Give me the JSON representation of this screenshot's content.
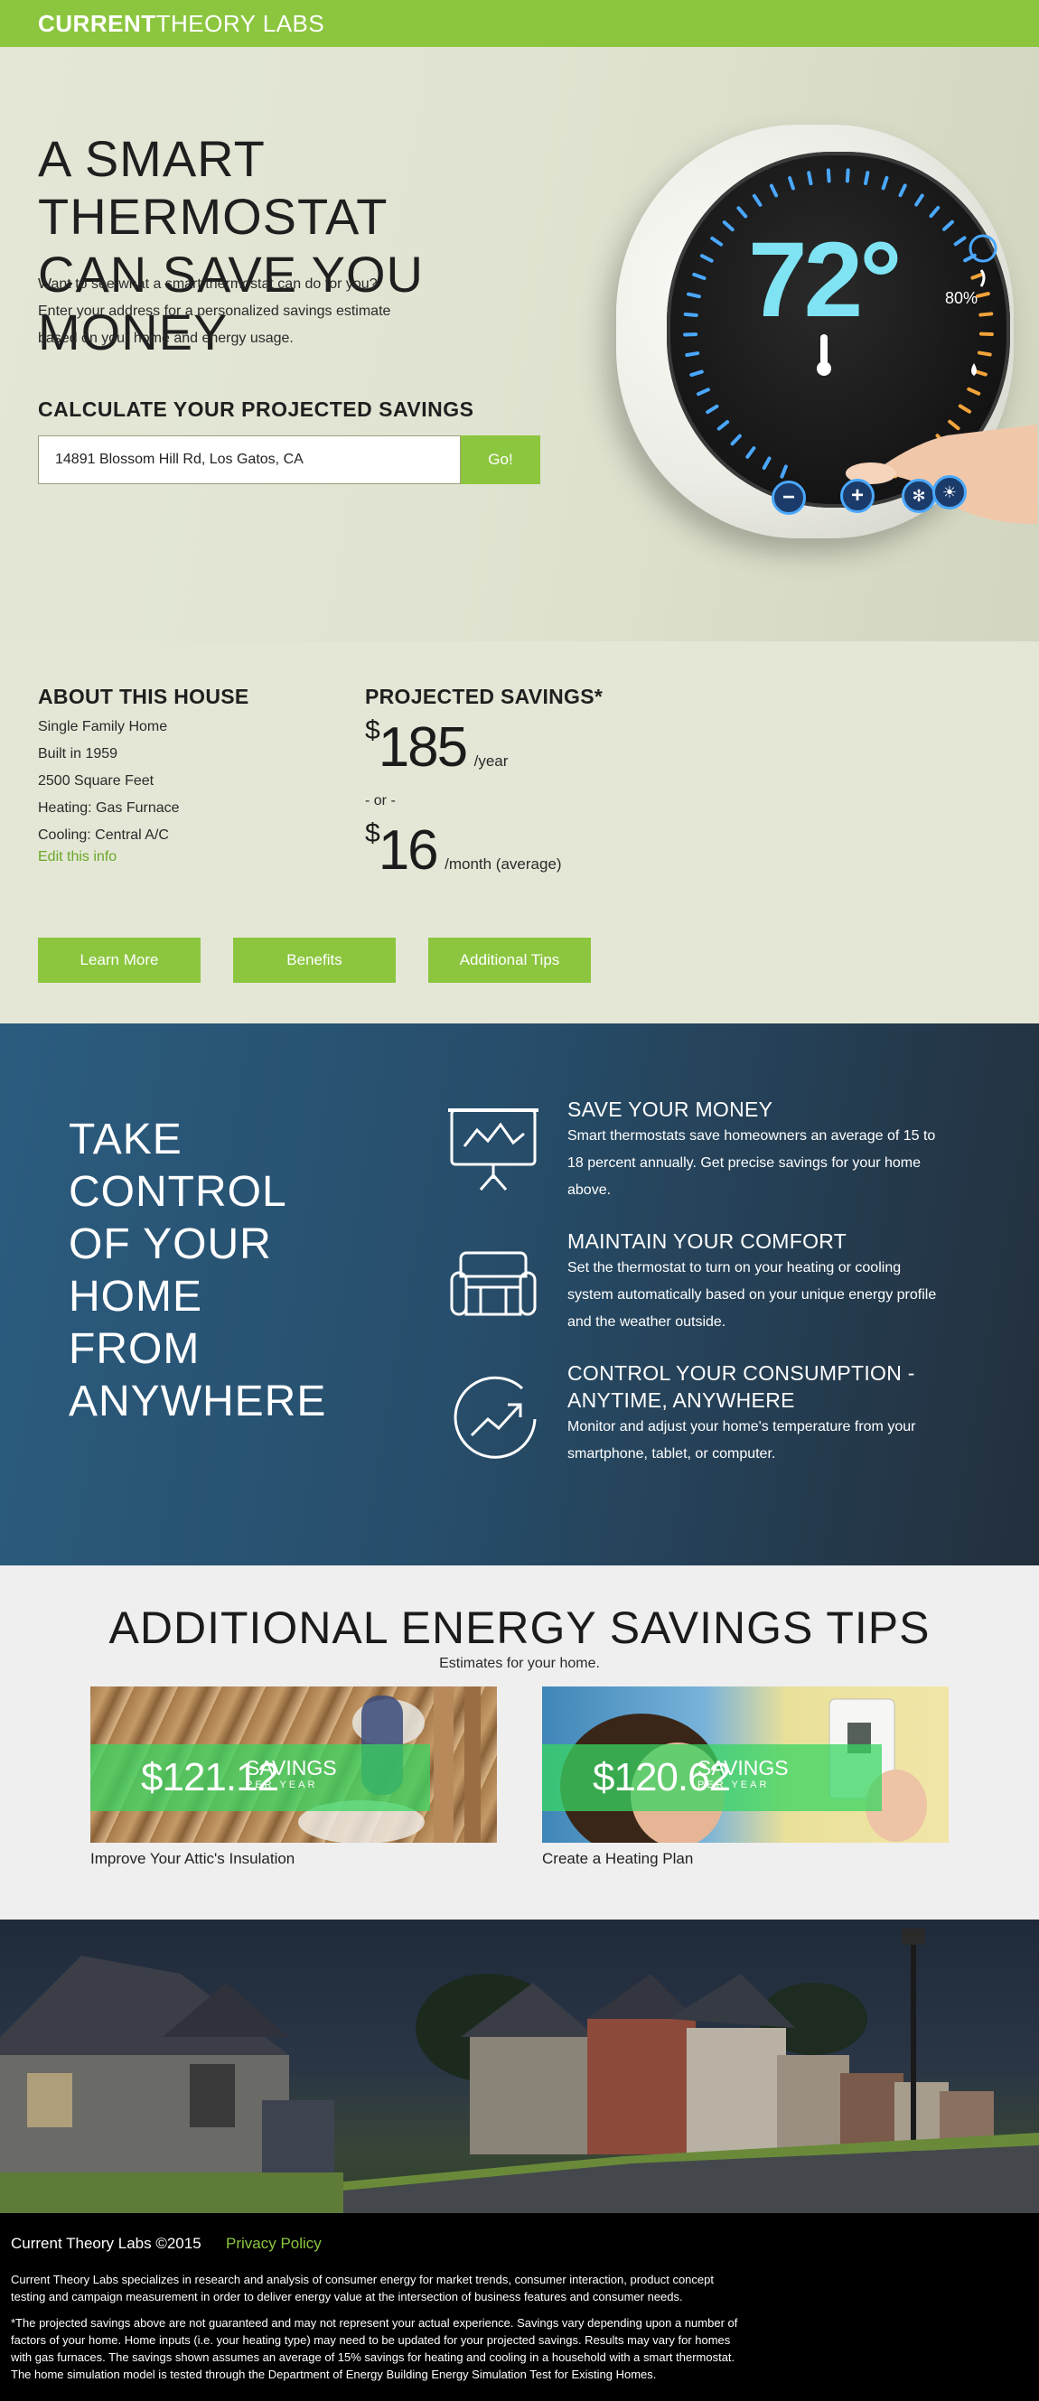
{
  "brand": {
    "bold": "CURRENT",
    "light": "THEORY LABS"
  },
  "hero": {
    "title_line1": "A SMART THERMOSTAT",
    "title_line2": "CAN SAVE YOU MONEY",
    "desc_line1": "Want to see what a smart thermostat can do for you?",
    "desc_line2": "Enter your address for a personalized savings estimate",
    "desc_line3": "based on your home and energy usage.",
    "calc_heading": "CALCULATE YOUR PROJECTED SAVINGS",
    "address_value": "14891 Blossom Hill Rd, Los Gatos, CA",
    "go_label": "Go!",
    "thermostat_temp": "72°",
    "thermostat_humidity": "80%"
  },
  "house": {
    "heading": "ABOUT THIS HOUSE",
    "details": [
      "Single Family Home",
      "Built in 1959",
      "2500 Square Feet",
      "Heating: Gas Furnace",
      "Cooling: Central A/C"
    ],
    "edit_label": "Edit this info"
  },
  "savings": {
    "heading": "PROJECTED SAVINGS*",
    "currency": "$",
    "yearly_amount": "185",
    "yearly_unit": "/year",
    "or_text": "- or -",
    "monthly_amount": "16",
    "monthly_unit": "/month (average)"
  },
  "actions": {
    "learn_more": "Learn More",
    "benefits": "Benefits",
    "additional_tips": "Additional Tips"
  },
  "control": {
    "title_lines": [
      "TAKE",
      "CONTROL",
      "OF YOUR",
      "HOME",
      "FROM",
      "ANYWHERE"
    ],
    "features": [
      {
        "icon": "presentation-chart-icon",
        "title": "SAVE YOUR MONEY",
        "text_lines": [
          "Smart thermostats save homeowners an average of 15 to",
          "18 percent annually. Get precise savings for your home",
          "above."
        ]
      },
      {
        "icon": "armchair-icon",
        "title": "MAINTAIN YOUR COMFORT",
        "text_lines": [
          "Set the thermostat to turn on your heating or cooling",
          "system automatically based on your unique energy profile",
          "and the weather outside."
        ]
      },
      {
        "icon": "trend-up-icon",
        "title_line1": "CONTROL YOUR CONSUMPTION -",
        "title_line2": "ANYTIME, ANYWHERE",
        "text_lines": [
          "Monitor and adjust your home's temperature from your",
          "smartphone, tablet, or computer."
        ]
      }
    ]
  },
  "tips": {
    "title": "ADDITIONAL ENERGY SAVINGS TIPS",
    "subtitle": "Estimates for your home.",
    "savings_word": "SAVINGS",
    "per_year": "PER YEAR",
    "cards": [
      {
        "value": "$121.12",
        "label": "Improve Your Attic's Insulation"
      },
      {
        "value": "$120.62",
        "label": "Create a Heating Plan"
      }
    ]
  },
  "footer": {
    "copyright": "Current Theory Labs ©2015",
    "privacy": "Privacy Policy",
    "about_line1": "Current Theory Labs specializes in research and analysis of consumer energy for market trends, consumer interaction, product concept",
    "about_line2": "testing and campaign measurement in order to deliver energy value at the intersection of business features and consumer needs.",
    "disclaimer_lines": [
      "*The projected savings above are not guaranteed and may not represent your actual experience. Savings vary depending upon a number of",
      "factors of your home. Home inputs (i.e. your heating type) may need to be updated for your projected savings. Results may vary for homes",
      "with gas furnaces. The savings shown assumes an average of 15% savings for heating and cooling in a household with a smart thermostat.",
      "The home simulation model is tested through the Department of Energy Building Energy Simulation Test for Existing Homes."
    ]
  },
  "colors": {
    "brand_green": "#8cc63f",
    "hero_bg": "#e4e7d6",
    "control_bg": "#2b5c7f",
    "footer_bg": "#000000",
    "thermostat_cyan": "#7fe3f3"
  }
}
